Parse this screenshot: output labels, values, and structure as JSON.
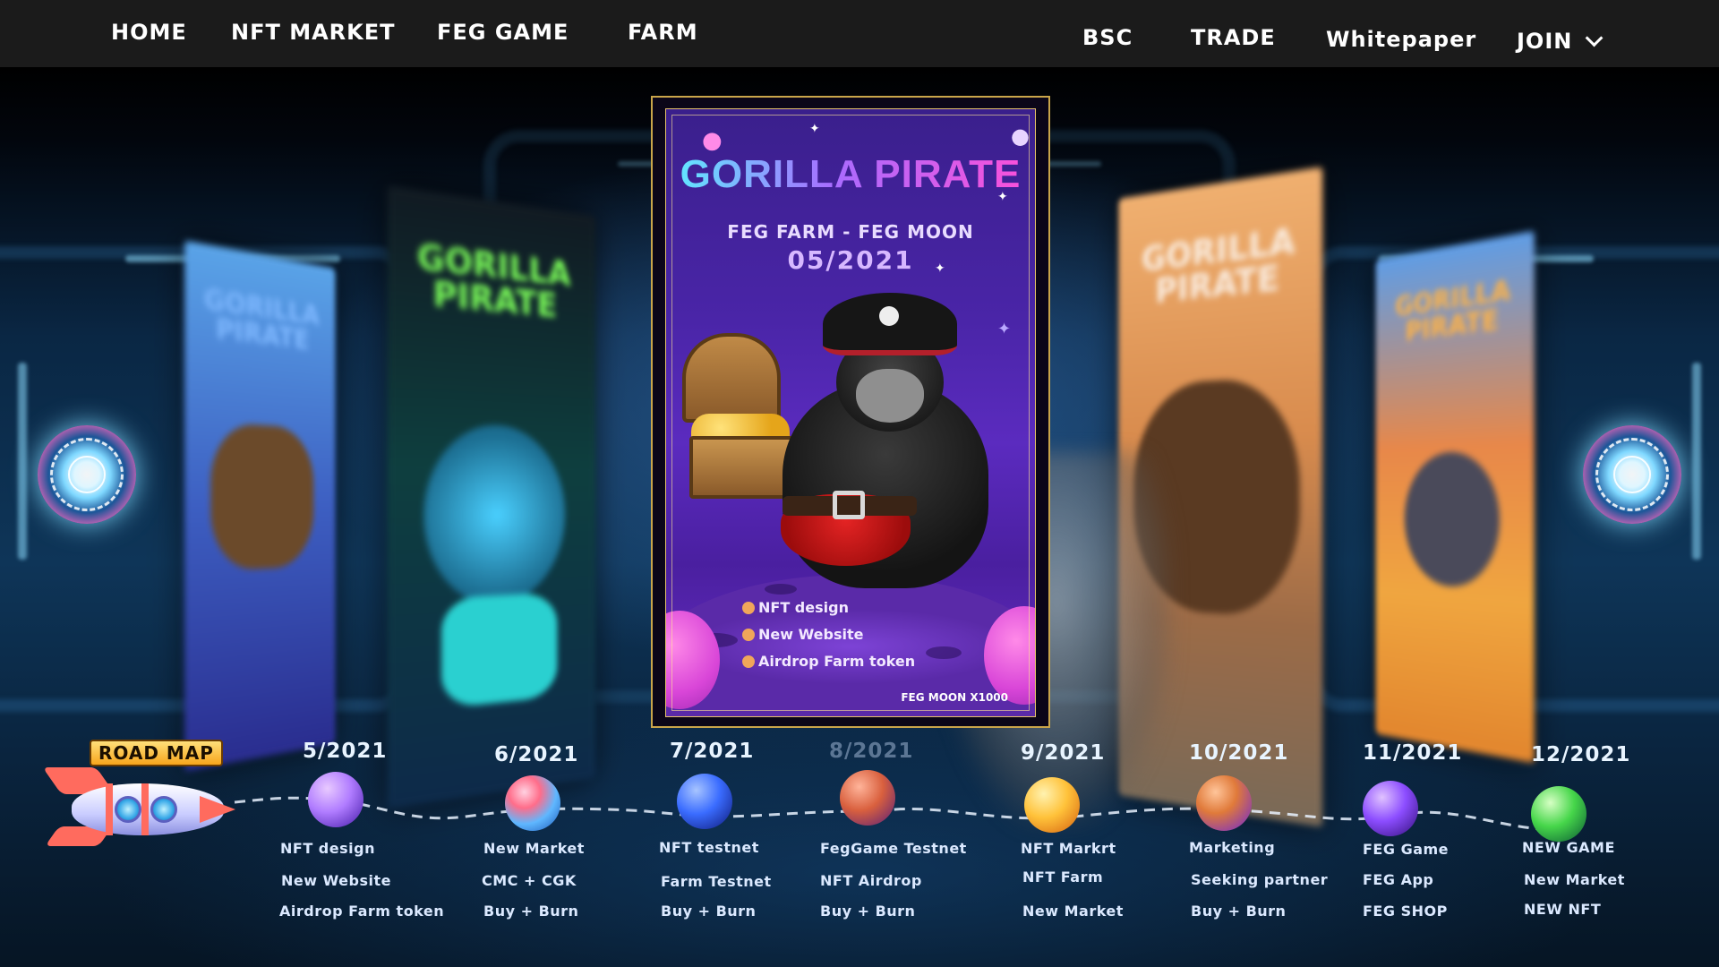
{
  "nav": {
    "home": "HOME",
    "nft_market": "NFT MARKET",
    "feg_game": "FEG GAME",
    "farm": "FARM",
    "bsc": "BSC",
    "trade": "TRADE",
    "whitepaper": "Whitepaper",
    "join": "JOIN"
  },
  "featured_card": {
    "title": "GORILLA PIRATE",
    "subtitle": "FEG FARM - FEG MOON",
    "date": "05/2021",
    "items": [
      "NFT design",
      "New Website",
      "Airdrop Farm token"
    ],
    "footer": "FEG MOON X1000"
  },
  "side_cards": [
    {
      "title": "GORILLA PIRATE"
    },
    {
      "title": "GORILLA PIRATE"
    },
    {
      "title": "GORILLA PIRATE"
    },
    {
      "title": "GORILLA PIRATE"
    }
  ],
  "roadmap": {
    "label": "ROAD MAP",
    "milestones": [
      {
        "date": "5/2021",
        "items": [
          "NFT design",
          "New Website",
          "Airdrop Farm token"
        ],
        "planet_color": "#b07cff"
      },
      {
        "date": "6/2021",
        "items": [
          "New Market",
          "CMC + CGK",
          "Buy + Burn"
        ],
        "planet_color": "#ff6d8a"
      },
      {
        "date": "7/2021",
        "items": [
          "NFT testnet",
          "Farm Testnet",
          "Buy + Burn"
        ],
        "planet_color": "#3a6cff"
      },
      {
        "date": "8/2021",
        "items": [
          "FegGame Testnet",
          "NFT Airdrop",
          "Buy + Burn"
        ],
        "planet_color": "#d9603e"
      },
      {
        "date": "9/2021",
        "items": [
          "NFT Markrt",
          "NFT Farm",
          "New Market"
        ],
        "planet_color": "#ffc23a"
      },
      {
        "date": "10/2021",
        "items": [
          "Marketing",
          "Seeking partner",
          "Buy + Burn"
        ],
        "planet_color": "#e07a3a"
      },
      {
        "date": "11/2021",
        "items": [
          "FEG Game",
          "FEG App",
          "FEG SHOP"
        ],
        "planet_color": "#8c4dff"
      },
      {
        "date": "12/2021",
        "items": [
          "NEW GAME",
          "New Market",
          "NEW NFT"
        ],
        "planet_color": "#46d64a"
      }
    ]
  }
}
